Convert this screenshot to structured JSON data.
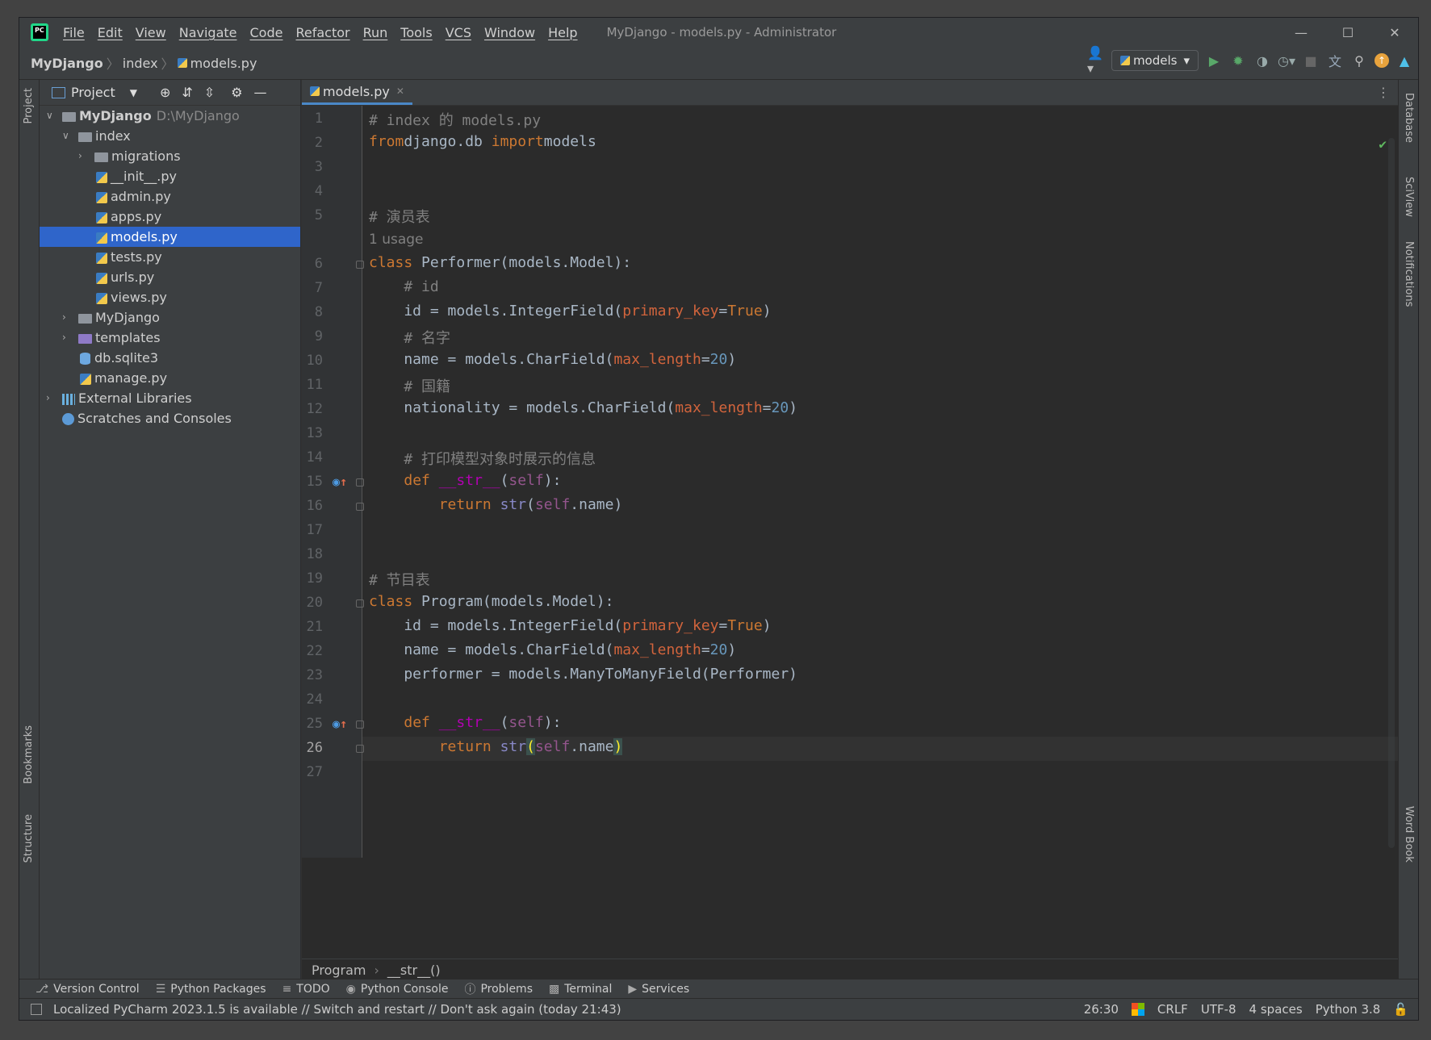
{
  "window": {
    "title": "MyDjango - models.py - Administrator",
    "logo": "PC"
  },
  "menu": [
    "File",
    "Edit",
    "View",
    "Navigate",
    "Code",
    "Refactor",
    "Run",
    "Tools",
    "VCS",
    "Window",
    "Help"
  ],
  "breadcrumb": {
    "project": "MyDjango",
    "dir": "index",
    "file": "models.py"
  },
  "toolbar": {
    "run_config": "models"
  },
  "sidebar_left": {
    "project_label": "Project",
    "bookmarks_label": "Bookmarks",
    "structure_label": "Structure"
  },
  "sidebar_right": {
    "database": "Database",
    "sciview": "SciView",
    "notifications": "Notifications",
    "wordbook": "Word Book"
  },
  "project_panel": {
    "title": "Project"
  },
  "tree": {
    "root": {
      "label": "MyDjango",
      "path": "D:\\MyDjango"
    },
    "index": "index",
    "migrations": "migrations",
    "init": "__init__.py",
    "admin": "admin.py",
    "apps": "apps.py",
    "models": "models.py",
    "tests": "tests.py",
    "urls": "urls.py",
    "views": "views.py",
    "mydjango": "MyDjango",
    "templates": "templates",
    "db": "db.sqlite3",
    "manage": "manage.py",
    "external": "External Libraries",
    "scratches": "Scratches and Consoles"
  },
  "editor": {
    "tab": "models.py",
    "usage_hint": "1 usage",
    "current_line": 26,
    "lines": [
      [
        [
          "cm",
          "# index 的 models.py"
        ]
      ],
      [
        [
          "kw",
          "from"
        ],
        [
          "",
          "django.db "
        ],
        [
          "kw",
          "import"
        ],
        [
          "",
          "models"
        ]
      ],
      [],
      [],
      [
        [
          "cm",
          "# 演员表"
        ]
      ],
      [
        [
          "kw",
          "class"
        ],
        [
          "",
          " Performer(models.Model):"
        ]
      ],
      [
        [
          "",
          "    "
        ],
        [
          "cm",
          "# id"
        ]
      ],
      [
        [
          "",
          "    id = models.IntegerField("
        ],
        [
          "prm",
          "primary_key"
        ],
        [
          "",
          "="
        ],
        [
          "kw",
          "True"
        ],
        [
          "",
          ")"
        ]
      ],
      [
        [
          "",
          "    "
        ],
        [
          "cm",
          "# 名字"
        ]
      ],
      [
        [
          "",
          "    name = models.CharField("
        ],
        [
          "prm",
          "max_length"
        ],
        [
          "",
          "="
        ],
        [
          "num",
          "20"
        ],
        [
          "",
          ")"
        ]
      ],
      [
        [
          "",
          "    "
        ],
        [
          "cm",
          "# 国籍"
        ]
      ],
      [
        [
          "",
          "    nationality = models.CharField("
        ],
        [
          "prm",
          "max_length"
        ],
        [
          "",
          "="
        ],
        [
          "num",
          "20"
        ],
        [
          "",
          ")"
        ]
      ],
      [],
      [
        [
          "",
          "    "
        ],
        [
          "cm",
          "# 打印模型对象时展示的信息"
        ]
      ],
      [
        [
          "",
          "    "
        ],
        [
          "kw",
          "def"
        ],
        [
          "",
          " "
        ],
        [
          "mg",
          "__str__"
        ],
        [
          "",
          "("
        ],
        [
          "sf",
          "self"
        ],
        [
          "",
          "):"
        ]
      ],
      [
        [
          "",
          "        "
        ],
        [
          "kw",
          "return"
        ],
        [
          "",
          " "
        ],
        [
          "bi",
          "str"
        ],
        [
          "",
          "("
        ],
        [
          "sf",
          "self"
        ],
        [
          "",
          ".name)"
        ]
      ],
      [],
      [],
      [
        [
          "cm",
          "# 节目表"
        ]
      ],
      [
        [
          "kw",
          "class"
        ],
        [
          "",
          " Program(models.Model):"
        ]
      ],
      [
        [
          "",
          "    id = models.IntegerField("
        ],
        [
          "prm",
          "primary_key"
        ],
        [
          "",
          "="
        ],
        [
          "kw",
          "True"
        ],
        [
          "",
          ")"
        ]
      ],
      [
        [
          "",
          "    name = models.CharField("
        ],
        [
          "prm",
          "max_length"
        ],
        [
          "",
          "="
        ],
        [
          "num",
          "20"
        ],
        [
          "",
          ")"
        ]
      ],
      [
        [
          "",
          "    performer = models.ManyToManyField(Performer)"
        ]
      ],
      [],
      [
        [
          "",
          "    "
        ],
        [
          "kw",
          "def"
        ],
        [
          "",
          " "
        ],
        [
          "mg",
          "__str__"
        ],
        [
          "",
          "("
        ],
        [
          "sf",
          "self"
        ],
        [
          "",
          "):"
        ]
      ],
      [
        [
          "",
          "        "
        ],
        [
          "kw",
          "return"
        ],
        [
          "",
          " "
        ],
        [
          "bi",
          "str"
        ],
        [
          "brk",
          "("
        ],
        [
          "sf",
          "self"
        ],
        [
          "",
          ".name"
        ],
        [
          "brk",
          ")"
        ]
      ],
      []
    ],
    "breadcrumb": [
      "Program",
      "__str__()"
    ]
  },
  "tool_windows": [
    "Version Control",
    "Python Packages",
    "TODO",
    "Python Console",
    "Problems",
    "Terminal",
    "Services"
  ],
  "status": {
    "message": "Localized PyCharm 2023.1.5 is available // Switch and restart // Don't ask again (today 21:43)",
    "position": "26:30",
    "line_sep": "CRLF",
    "encoding": "UTF-8",
    "indent": "4 spaces",
    "interpreter": "Python 3.8"
  }
}
